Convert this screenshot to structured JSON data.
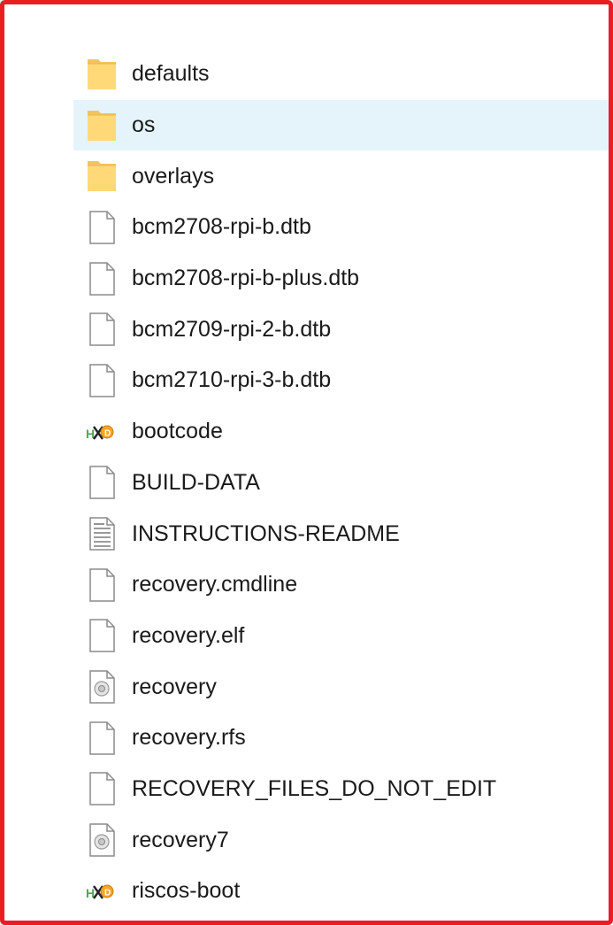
{
  "window": {
    "border_color": "#ec1c24",
    "selection_color": "#e5f3fb"
  },
  "files": [
    {
      "name": "defaults",
      "icon": "folder-icon",
      "selected": false
    },
    {
      "name": "os",
      "icon": "folder-icon",
      "selected": true
    },
    {
      "name": "overlays",
      "icon": "folder-icon",
      "selected": false
    },
    {
      "name": "bcm2708-rpi-b.dtb",
      "icon": "file-icon",
      "selected": false
    },
    {
      "name": "bcm2708-rpi-b-plus.dtb",
      "icon": "file-icon",
      "selected": false
    },
    {
      "name": "bcm2709-rpi-2-b.dtb",
      "icon": "file-icon",
      "selected": false
    },
    {
      "name": "bcm2710-rpi-3-b.dtb",
      "icon": "file-icon",
      "selected": false
    },
    {
      "name": "bootcode",
      "icon": "hex-file-icon",
      "selected": false
    },
    {
      "name": "BUILD-DATA",
      "icon": "file-icon",
      "selected": false
    },
    {
      "name": "INSTRUCTIONS-README",
      "icon": "text-file-icon",
      "selected": false
    },
    {
      "name": "recovery.cmdline",
      "icon": "file-icon",
      "selected": false
    },
    {
      "name": "recovery.elf",
      "icon": "file-icon",
      "selected": false
    },
    {
      "name": "recovery",
      "icon": "disc-image-icon",
      "selected": false
    },
    {
      "name": "recovery.rfs",
      "icon": "file-icon",
      "selected": false
    },
    {
      "name": "RECOVERY_FILES_DO_NOT_EDIT",
      "icon": "file-icon",
      "selected": false
    },
    {
      "name": "recovery7",
      "icon": "disc-image-icon",
      "selected": false
    },
    {
      "name": "riscos-boot",
      "icon": "hex-file-icon",
      "selected": false
    }
  ]
}
